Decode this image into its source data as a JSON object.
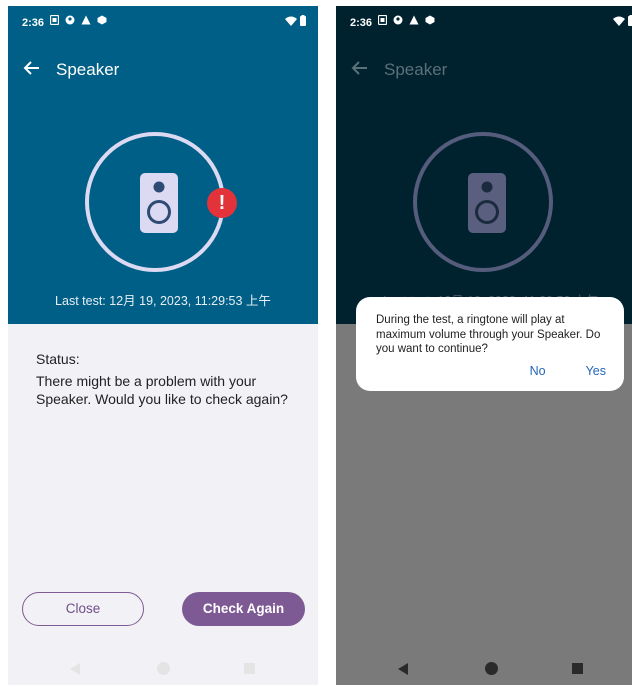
{
  "left_screen": {
    "status_bar": {
      "time": "2:36"
    },
    "app_bar": {
      "title": "Speaker"
    },
    "last_test": "Last test: 12月 19, 2023, 11:29:53 上午",
    "status_label": "Status:",
    "status_text": "There might be a problem with your Speaker. Would you like to check again?",
    "buttons": {
      "close": "Close",
      "check_again": "Check Again"
    },
    "colors": {
      "header": "#005f86",
      "accent": "#7e5a95",
      "warning": "#e2323a"
    }
  },
  "right_screen": {
    "status_bar": {
      "time": "2:36"
    },
    "app_bar": {
      "title": "Speaker"
    },
    "last_test": "Last test: 12月 19, 2023, 11:29:53 上午",
    "dialog": {
      "message": "During the test, a ringtone will play at maximum volume through your Speaker. Do you want to continue?",
      "no_label": "No",
      "yes_label": "Yes"
    }
  },
  "icons": [
    "back-arrow-icon",
    "speaker-icon",
    "warning-icon",
    "wifi-icon",
    "battery-icon",
    "nav-back-icon",
    "nav-home-icon",
    "nav-recents-icon"
  ]
}
